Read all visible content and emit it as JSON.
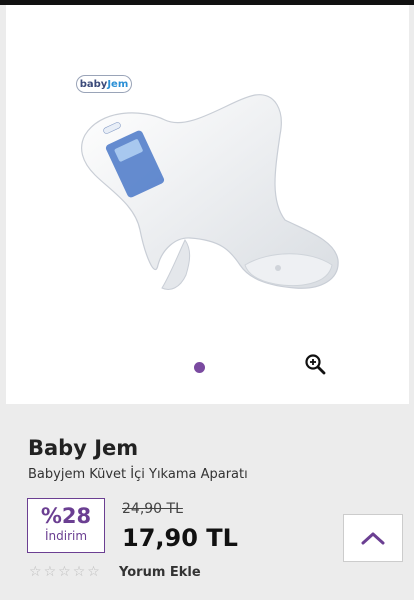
{
  "product": {
    "logo_text_prefix": "baby",
    "logo_text_suffix": "Jem",
    "brand": "Baby Jem",
    "name": "Babyjem Küvet İçi Yıkama Aparatı",
    "discount_percent": "%28",
    "discount_label": "İndirim",
    "old_price": "24,90 TL",
    "price": "17,90 TL",
    "rating_stars": 0,
    "review_action": "Yorum Ekle"
  },
  "gallery": {
    "current_index": 1,
    "total_images": 1,
    "zoom_icon": "zoom-in-icon"
  },
  "colors": {
    "accent": "#6b3f92",
    "dot": "#7a4aa0"
  }
}
